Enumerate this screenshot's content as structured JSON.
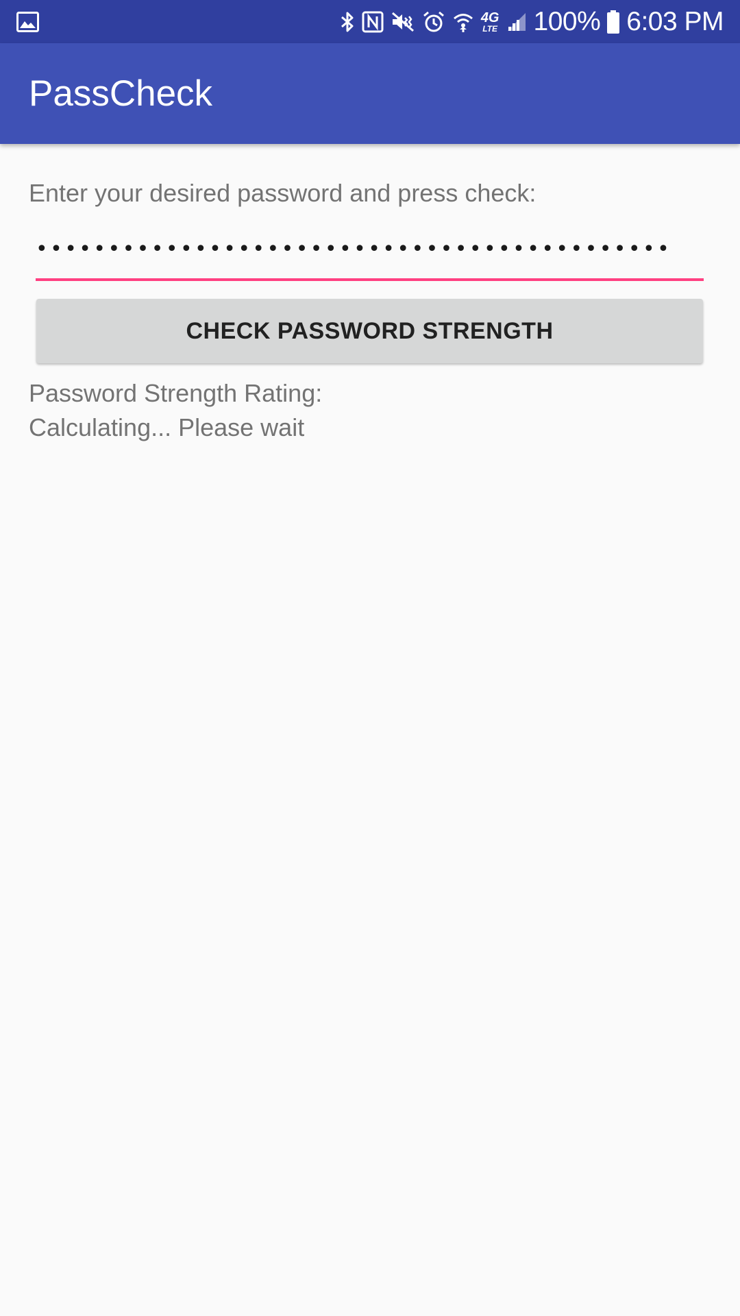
{
  "status_bar": {
    "left_icon": "image-notification-icon",
    "icons": [
      "bluetooth-icon",
      "nfc-icon",
      "vibrate-mute-icon",
      "alarm-icon",
      "wifi-icon",
      "lte-icon",
      "signal-icon"
    ],
    "network_label": "4G",
    "network_sub_label": "LTE",
    "battery_percent": "100%",
    "time": "6:03 PM"
  },
  "app_bar": {
    "title": "PassCheck"
  },
  "form": {
    "prompt": "Enter your desired password and press check:",
    "password_value": "••••••••••••••••••••••••••••••••••••••••••••",
    "check_button_label": "CHECK PASSWORD STRENGTH"
  },
  "result": {
    "label": "Password Strength Rating:",
    "value": "Calculating... Please wait"
  },
  "colors": {
    "status_bar": "#303f9f",
    "app_bar": "#3f51b5",
    "accent": "#ff4081",
    "button": "#d6d7d7",
    "background": "#fafafa"
  }
}
